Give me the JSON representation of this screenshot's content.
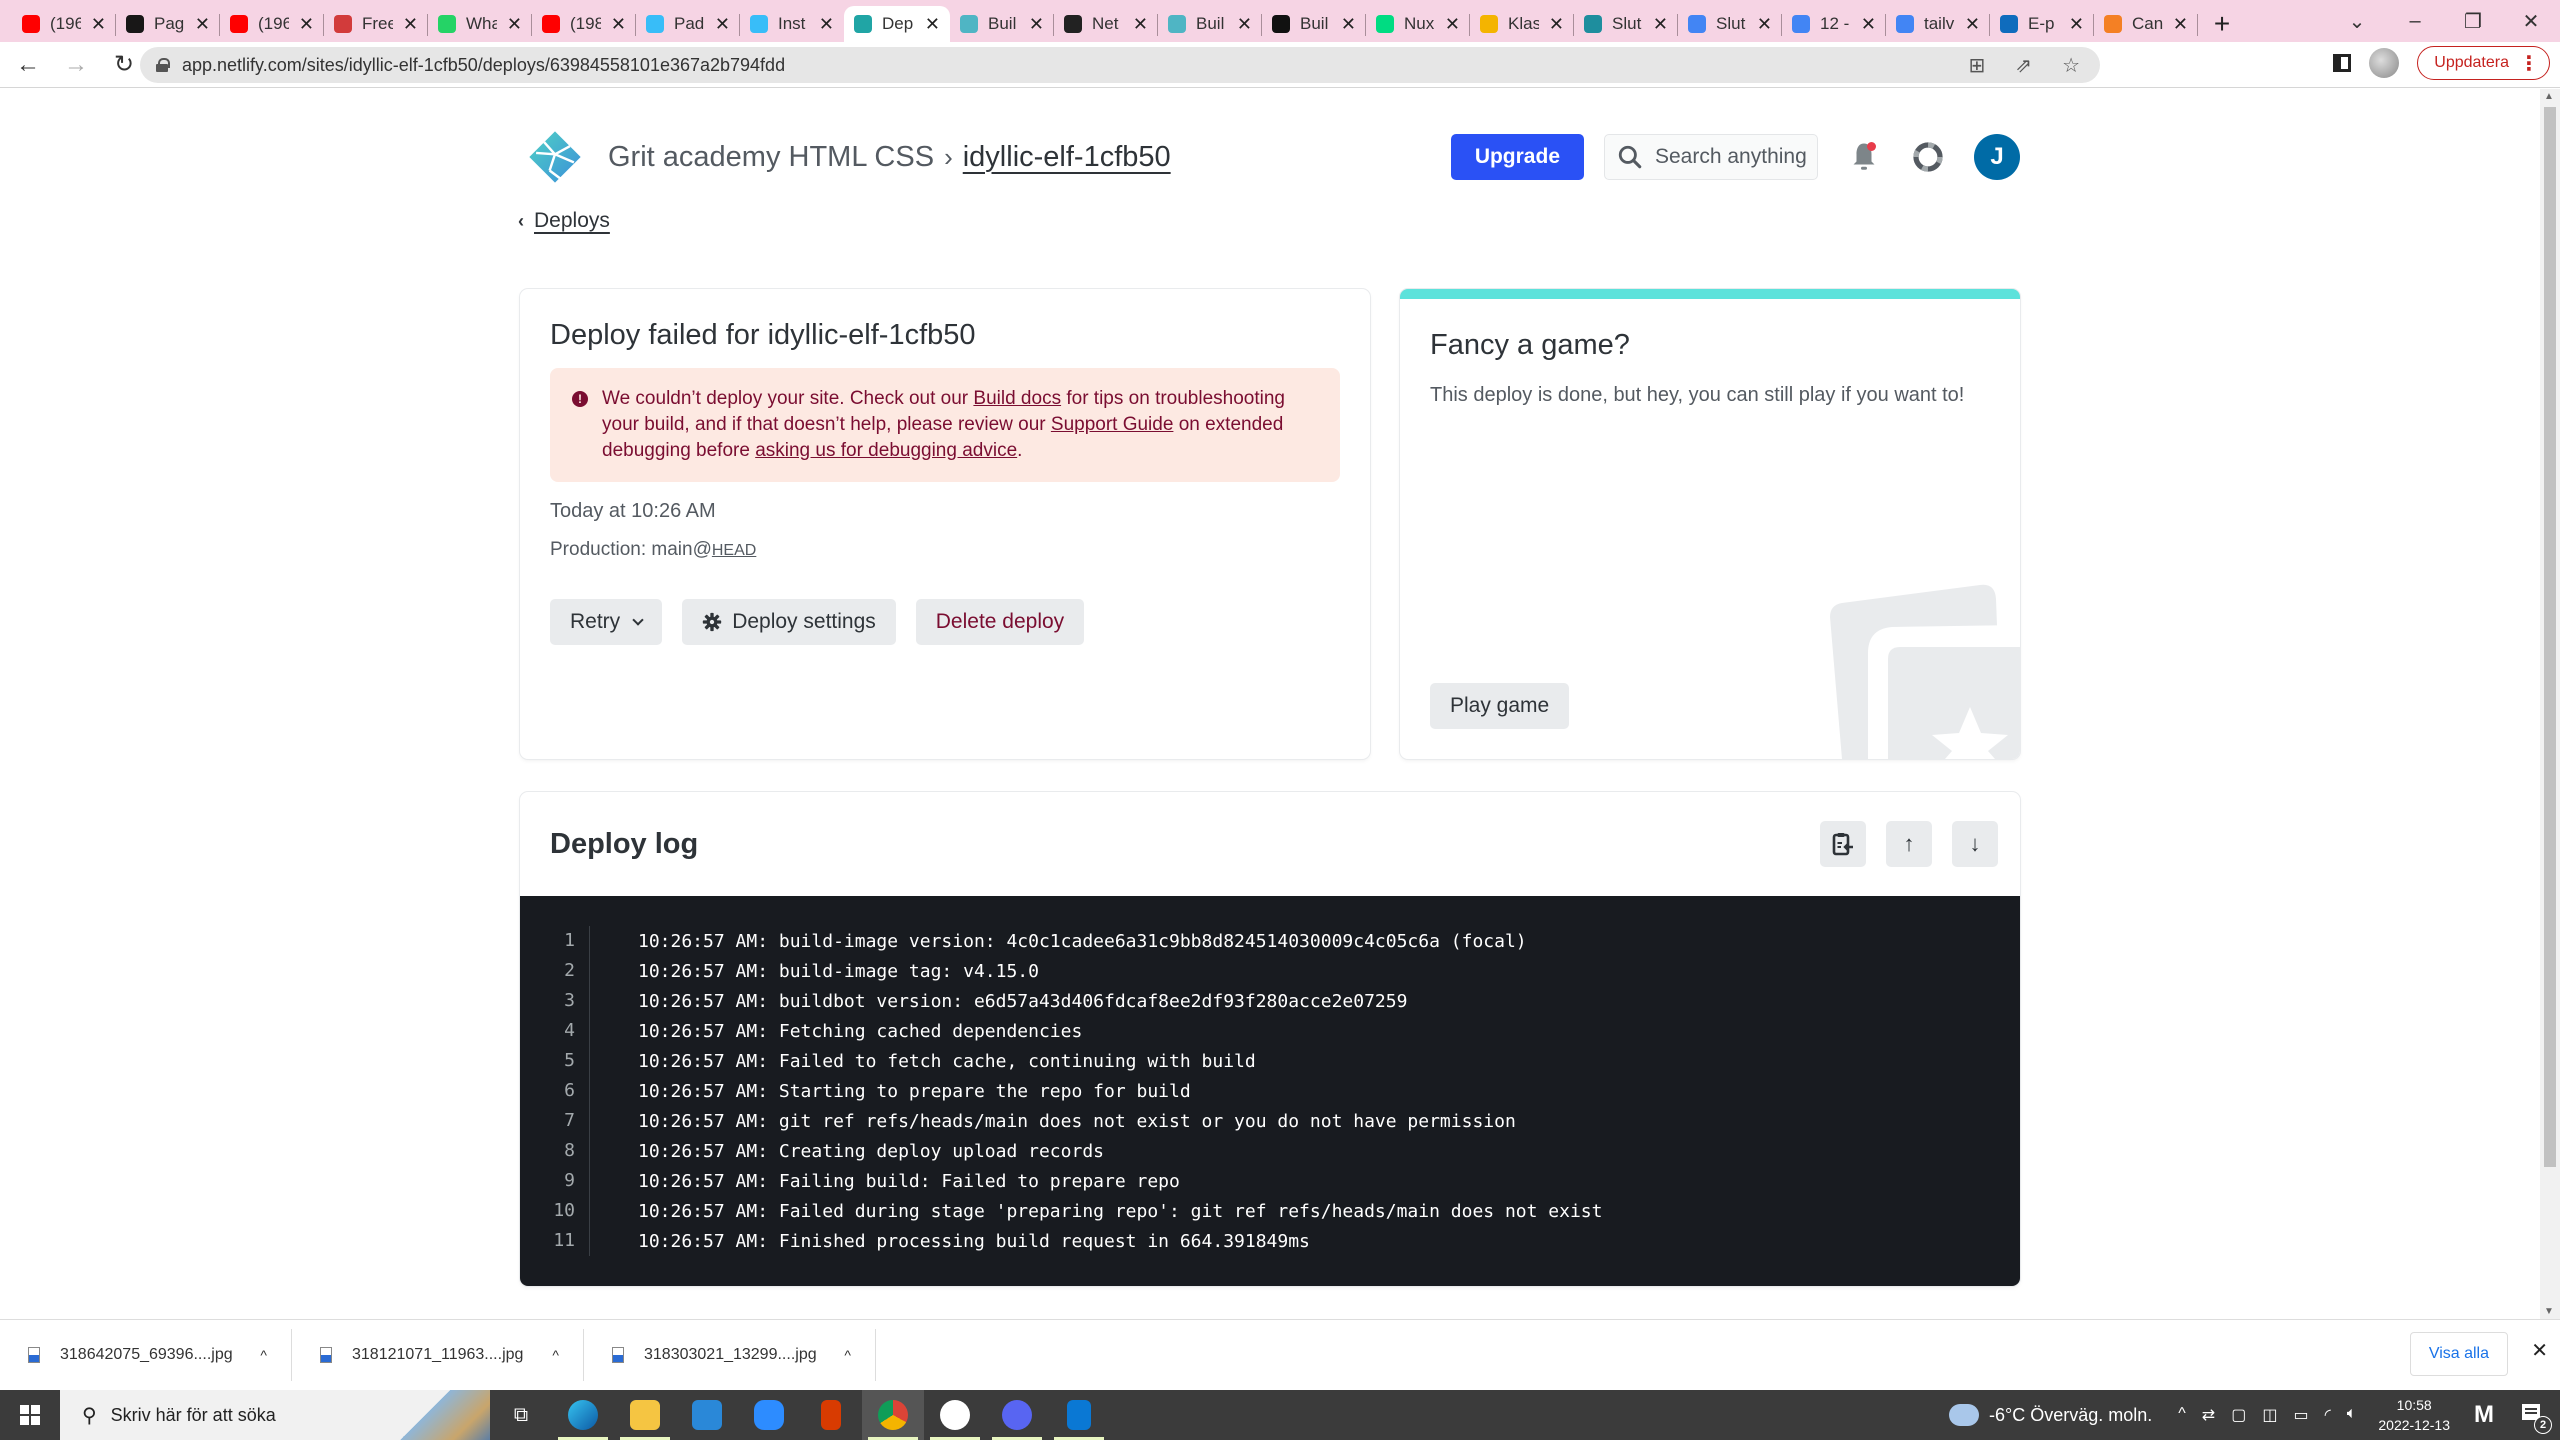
{
  "browser": {
    "tabs": [
      {
        "title": "(196",
        "icon": "youtube-icon",
        "color": "#ff0000"
      },
      {
        "title": "Pag",
        "icon": "github-icon",
        "color": "#181717"
      },
      {
        "title": "(196",
        "icon": "youtube-icon",
        "color": "#ff0000"
      },
      {
        "title": "Free",
        "icon": "cocktail-icon",
        "color": "#d23b3b"
      },
      {
        "title": "Wha",
        "icon": "whatsapp-icon",
        "color": "#25d366"
      },
      {
        "title": "(198",
        "icon": "youtube-icon",
        "color": "#ff0000"
      },
      {
        "title": "Pad",
        "icon": "tailwind-icon",
        "color": "#38bdf8"
      },
      {
        "title": "Inst",
        "icon": "tailwind-icon",
        "color": "#38bdf8"
      },
      {
        "title": "Dep",
        "icon": "netlify-failed-icon",
        "color": "#20a5a5",
        "active": true
      },
      {
        "title": "Buil",
        "icon": "netlify-icon",
        "color": "#4fb5c4"
      },
      {
        "title": "Net",
        "icon": "netlify-dark-icon",
        "color": "#222222"
      },
      {
        "title": "Buil",
        "icon": "netlify-icon",
        "color": "#4fb5c4"
      },
      {
        "title": "Buil",
        "icon": "circleci-icon",
        "color": "#111111"
      },
      {
        "title": "Nux",
        "icon": "nuxt-icon",
        "color": "#00dc82"
      },
      {
        "title": "Klas",
        "icon": "classroom-icon",
        "color": "#f4b400"
      },
      {
        "title": "Slut",
        "icon": "classroom-icon",
        "color": "#1e8e9e"
      },
      {
        "title": "Slut",
        "icon": "docs-icon",
        "color": "#4285f4"
      },
      {
        "title": "12 -",
        "icon": "docs-icon",
        "color": "#4285f4"
      },
      {
        "title": "tailv",
        "icon": "google-icon",
        "color": "#4285f4"
      },
      {
        "title": "E-p",
        "icon": "outlook-icon",
        "color": "#0f6cbd"
      },
      {
        "title": "Can",
        "icon": "stackoverflow-icon",
        "color": "#f48024"
      }
    ],
    "new_tab_label": "+",
    "url": "app.netlify.com/sites/idyllic-elf-1cfb50/deploys/63984558101e367a2b794fdd",
    "update_button": "Uppdatera"
  },
  "header": {
    "team": "Grit academy HTML CSS",
    "separator": "›",
    "site": "idyllic-elf-1cfb50",
    "upgrade": "Upgrade",
    "search_placeholder": "Search anything",
    "avatar_initial": "J",
    "accent": "#2a51f5"
  },
  "back_link": "Deploys",
  "deploy_card": {
    "title": "Deploy failed for idyllic-elf-1cfb50",
    "alert": {
      "part1": "We couldn’t deploy your site. Check out our ",
      "link1": "Build docs",
      "part2": " for tips on troubleshooting your build, and if that doesn’t help, please review our ",
      "link2": "Support Guide",
      "part3": " on extended debugging before ",
      "link3": "asking us for debugging advice",
      "part4": "."
    },
    "time": "Today at 10:26 AM",
    "production_label": "Production: main@",
    "production_ref": "HEAD",
    "buttons": {
      "retry": "Retry",
      "settings": "Deploy settings",
      "delete": "Delete deploy"
    }
  },
  "game_card": {
    "title": "Fancy a game?",
    "description": "This deploy is done, but hey, you can still play if you want to!",
    "button": "Play game",
    "accent": "#5de2db"
  },
  "deploy_log": {
    "title": "Deploy log",
    "lines": [
      {
        "n": "1",
        "text": "10:26:57 AM: build-image version: 4c0c1cadee6a31c9bb8d824514030009c4c05c6a (focal)"
      },
      {
        "n": "2",
        "text": "10:26:57 AM: build-image tag: v4.15.0"
      },
      {
        "n": "3",
        "text": "10:26:57 AM: buildbot version: e6d57a43d406fdcaf8ee2df93f280acce2e07259"
      },
      {
        "n": "4",
        "text": "10:26:57 AM: Fetching cached dependencies"
      },
      {
        "n": "5",
        "text": "10:26:57 AM: Failed to fetch cache, continuing with build"
      },
      {
        "n": "6",
        "text": "10:26:57 AM: Starting to prepare the repo for build"
      },
      {
        "n": "7",
        "text": "10:26:57 AM: git ref refs/heads/main does not exist or you do not have permission"
      },
      {
        "n": "8",
        "text": "10:26:57 AM: Creating deploy upload records"
      },
      {
        "n": "9",
        "text": "10:26:57 AM: Failing build: Failed to prepare repo"
      },
      {
        "n": "10",
        "text": "10:26:57 AM: Failed during stage 'preparing repo': git ref refs/heads/main does not exist"
      },
      {
        "n": "11",
        "text": "10:26:57 AM: Finished processing build request in 664.391849ms"
      }
    ]
  },
  "downloads": {
    "items": [
      "318642075_69396....jpg",
      "318121071_11963....jpg",
      "318303021_13299....jpg"
    ],
    "show_all": "Visa alla"
  },
  "taskbar": {
    "search_placeholder": "Skriv här för att söka",
    "weather": "-6°C  Överväg. moln.",
    "time": "10:58",
    "date": "2022-12-13",
    "notification_count": "2"
  }
}
